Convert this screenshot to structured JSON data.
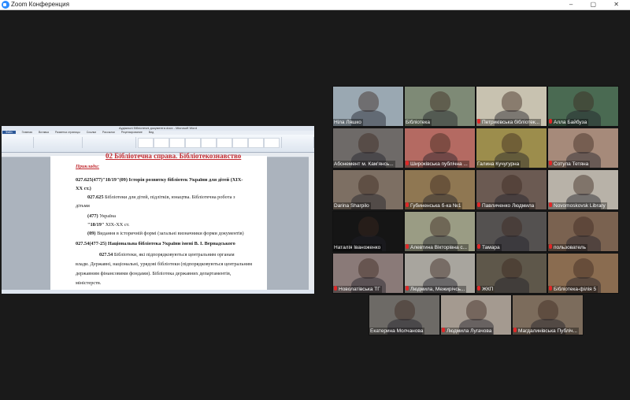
{
  "window": {
    "title": "Zoom Конференция"
  },
  "document": {
    "window_title": "Аудіальні бібліотечні документи.docx - Microsoft Word",
    "tabs": [
      "Файл",
      "Главная",
      "Вставка",
      "Разметка страницы",
      "Ссылки",
      "Рассылки",
      "Рецензирование",
      "Вид"
    ],
    "heading": "02 Бібліотечна справа. Бібліотекознавство",
    "example_label": "Приклади:",
    "lines": [
      {
        "text": "027.625(477)\"18/19\"(09) Історія розвитку  бібліотек України для дітей (XIX-",
        "bold": true
      },
      {
        "text": "XX ст.)",
        "bold": true
      },
      {
        "text_bold": "027.625",
        "text": " Бібліотеки для дітей, підлітків, юнацтва. Бібліотечна робота з"
      },
      {
        "text": "дітьми"
      },
      {
        "text_bold": "(477)",
        "text": " Україна"
      },
      {
        "text_bold": "\"18/19\"",
        "text": " XIX-XX ст."
      },
      {
        "text_bold": "(09)",
        "text": " Видання в історичній формі (загальні визначники форми документів)"
      },
      {
        "text": "027.54(477-25) Національна бібліотека України імені В. І. Вернадського",
        "bold": true
      },
      {
        "text_bold": "027.54",
        "text": " Бібліотеки, які підпорядковуються центральним органам"
      },
      {
        "text": "влади. Державні, національні, урядові бібліотеки (підпорядковуються центральним"
      },
      {
        "text": "державним фінансовими фондами). Бібліотека державних департаментів,"
      },
      {
        "text": "міністерств."
      }
    ]
  },
  "participants": [
    {
      "name": "Ніла Ляшко",
      "muted": false,
      "bg": "#9aa8b2"
    },
    {
      "name": "Бібліотека",
      "muted": false,
      "bg": "#7e8a76"
    },
    {
      "name": "Петриківська бібліотек...",
      "muted": true,
      "bg": "#c8c2b0"
    },
    {
      "name": "Алла Байбуза",
      "muted": true,
      "bg": "#4a6a52"
    },
    {
      "name": "Абонемент м. Кам'янсь...",
      "muted": false,
      "bg": "#6e6a68"
    },
    {
      "name": "Широківська публічна ...",
      "muted": true,
      "bg": "#b46a62"
    },
    {
      "name": "Галина Кучугурна",
      "muted": false,
      "bg": "#9c8d4c"
    },
    {
      "name": "Сотула Тетяна",
      "muted": true,
      "bg": "#a68a7a"
    },
    {
      "name": "Darina Sharpilo",
      "muted": false,
      "bg": "#7d6f63"
    },
    {
      "name": "Губиненська б-ка №1",
      "muted": true,
      "bg": "#8f7752"
    },
    {
      "name": "Павличенко Людмила",
      "muted": true,
      "bg": "#6b5a52"
    },
    {
      "name": "Novomoskovsk Library",
      "muted": true,
      "bg": "#b8b2a8"
    },
    {
      "name": "Наталія Іваноженко",
      "muted": false,
      "bg": "#151515"
    },
    {
      "name": "Алевтина Вікторівна с...",
      "muted": true,
      "bg": "#9a9c84"
    },
    {
      "name": "Тамара",
      "muted": true,
      "bg": "#545150"
    },
    {
      "name": "пользователь",
      "muted": true,
      "bg": "#7a6250"
    },
    {
      "name": "Новолатівська ТГ",
      "muted": true,
      "bg": "#8a7a78"
    },
    {
      "name": "Людмила, Межирічсь...",
      "muted": true,
      "bg": "#a8a59e"
    },
    {
      "name": "ЖКП",
      "muted": true,
      "bg": "#5e574a"
    },
    {
      "name": "Бібліотека-філія 5",
      "muted": true,
      "bg": "#8a6c50"
    },
    {
      "name": "Екатерина Молчанова",
      "muted": false,
      "bg": "#6d6a66"
    },
    {
      "name": "Людмила Лугачова",
      "muted": true,
      "bg": "#a49a90"
    },
    {
      "name": "Магдалинівська Публіч...",
      "muted": true,
      "bg": "#7c6c5c"
    }
  ]
}
